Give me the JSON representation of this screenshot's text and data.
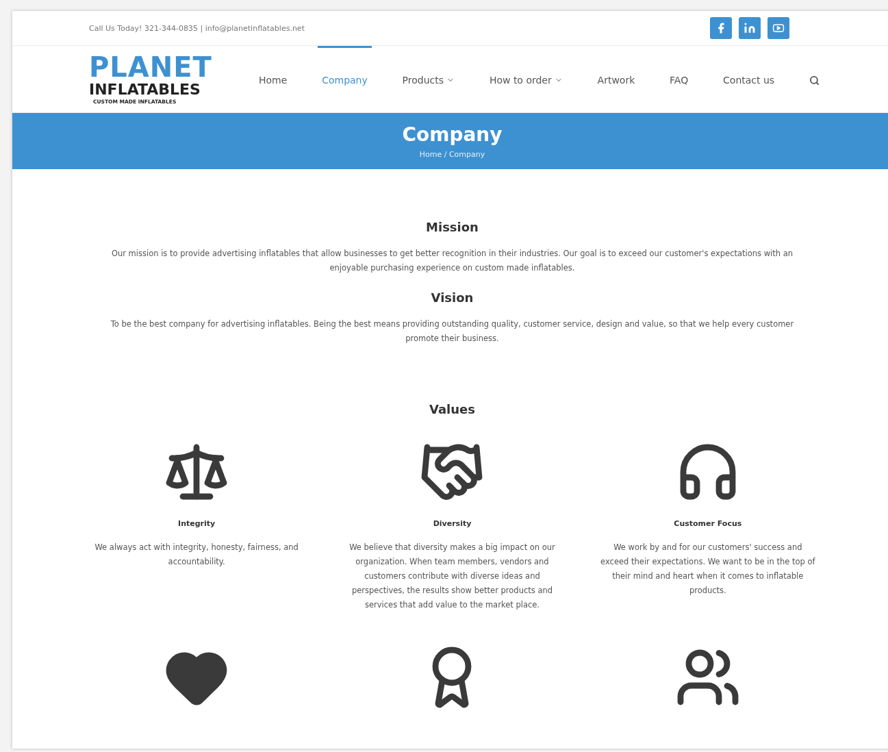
{
  "top_bar": {
    "contact": "Call Us Today! 321-344-0835 | info@planetinflatables.net"
  },
  "logo": {
    "line_1": "PLANET",
    "line_2": "INFLATABLES",
    "tagline": "CUSTOM MADE INFLATABLES"
  },
  "nav": {
    "items": [
      {
        "label": "Home",
        "selected": false,
        "dropdown": false
      },
      {
        "label": "Company",
        "selected": true,
        "dropdown": false
      },
      {
        "label": "Products",
        "selected": false,
        "dropdown": true
      },
      {
        "label": "How to order",
        "selected": false,
        "dropdown": true
      },
      {
        "label": "Artwork",
        "selected": false,
        "dropdown": false
      },
      {
        "label": "FAQ",
        "selected": false,
        "dropdown": false
      },
      {
        "label": "Contact us",
        "selected": false,
        "dropdown": false
      }
    ]
  },
  "banner": {
    "title": "Company",
    "breadcrumb": "Home / Company"
  },
  "sections": [
    {
      "heading": "Mission",
      "text": "Our mission is to provide advertising inflatables that allow businesses to get better recognition in their industries. Our goal is to exceed our customer's expectations with an enjoyable purchasing experience on custom made inflatables."
    },
    {
      "heading": "Vision",
      "text": "To be the best company for advertising inflatables. Being the best means providing outstanding quality, customer service, design and value, so that we help every customer promote their business."
    }
  ],
  "values": {
    "heading": "Values",
    "items": [
      {
        "title": "Integrity",
        "text": "We always act with integrity, honesty, fairness, and accountability."
      },
      {
        "title": "Diversity",
        "text": "We believe that diversity makes a big impact on our organization. When team members, vendors and customers contribute with diverse ideas and perspectives, the results show better products and services that add value to the market place."
      },
      {
        "title": "Customer Focus",
        "text": "We work by and for our customers' success and exceed their expectations. We want to be in the top of their mind and heart when it comes to inflatable products."
      }
    ]
  }
}
